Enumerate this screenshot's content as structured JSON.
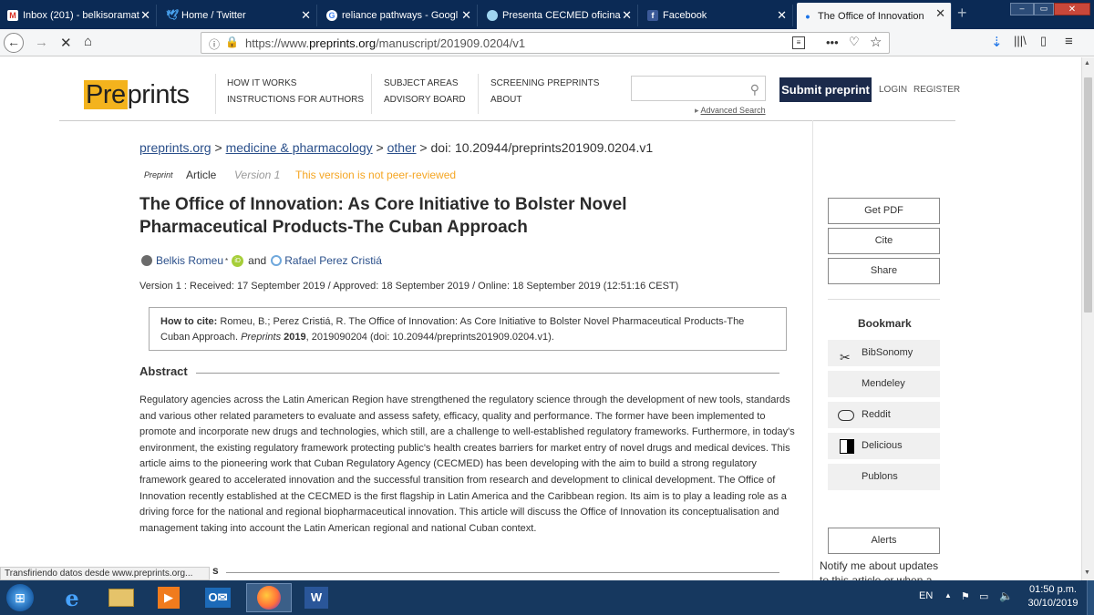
{
  "browser": {
    "tabs": [
      {
        "label": "Inbox (201) - belkisoramat",
        "icon": "gmail-icon"
      },
      {
        "label": "Home / Twitter",
        "icon": "twitter-icon"
      },
      {
        "label": "reliance pathways - Googl",
        "icon": "google-icon"
      },
      {
        "label": "Presenta CECMED oficina",
        "icon": "globe-icon"
      },
      {
        "label": "Facebook",
        "icon": "facebook-icon"
      },
      {
        "label": "The Office of Innovation",
        "icon": "preprints-icon"
      }
    ],
    "url_prefix": "https://www.",
    "url_domain": "preprints.org",
    "url_path": "/manuscript/201909.0204/v1",
    "status_text": "Transfiriendo datos desde www.preprints.org..."
  },
  "site": {
    "logo_highlight": "Pre",
    "logo_rest": "prints",
    "menu": {
      "how_it_works": "HOW IT WORKS",
      "instructions": "INSTRUCTIONS FOR AUTHORS",
      "subject_areas": "SUBJECT AREAS",
      "advisory_board": "ADVISORY BOARD",
      "screening": "SCREENING PREPRINTS",
      "about": "ABOUT"
    },
    "search_placeholder": "",
    "advanced_search": "Advanced Search",
    "submit": "Submit preprint",
    "login": "LOGIN",
    "register": "REGISTER"
  },
  "article": {
    "breadcrumb": {
      "home": "preprints.org",
      "sep1": " > ",
      "category": "medicine & pharmacology",
      "sep2": " > ",
      "subcategory": "other",
      "doi": " > doi: 10.20944/preprints201909.0204.v1"
    },
    "tag_preprint": "Preprint",
    "tag_article": "Article",
    "tag_version": "Version 1",
    "tag_review": "This version is not peer-reviewed",
    "title": "The Office of Innovation: As Core Initiative to Bolster Novel Pharmaceutical Products-The Cuban Approach",
    "author1": "Belkis Romeu",
    "author1_mark": "*",
    "and": "and",
    "author2": "Rafael Perez Cristiá",
    "dates": "Version 1 : Received: 17 September 2019 / Approved: 18 September 2019 / Online: 18 September 2019 (12:51:16 CEST)",
    "cite_label": "How to cite:",
    "cite_text1": " Romeu, B.; Perez Cristiá, R. The Office of Innovation: As Core Initiative to Bolster Novel Pharmaceutical Products-The Cuban Approach. ",
    "cite_journal": "Preprints",
    "cite_year": " 2019",
    "cite_text2": ", 2019090204 (doi: 10.20944/preprints201909.0204.v1).",
    "abstract_heading": "Abstract",
    "abstract": "Regulatory agencies across the Latin American Region have strengthened the regulatory science through the development of new tools, standards and various other related parameters to evaluate and assess safety, efficacy, quality and performance. The former have been implemented to promote and incorporate new drugs and technologies, which still, are a challenge to well-established regulatory frameworks. Furthermore, in today's environment, the existing regulatory framework protecting public's health creates barriers for market entry of novel drugs and medical devices. This article aims to the pioneering work that Cuban Regulatory Agency (CECMED) has been developing with the aim to build a strong regulatory framework geared to accelerated innovation and the successful transition from research and development to clinical development. The Office of Innovation recently established at the CECMED is the first flagship in Latin America and the Caribbean region. Its aim is to play a leading role as a driving force for the national and regional biopharmaceutical innovation. This article will discuss the Office of Innovation its conceptualisation and management taking into account the Latin American regional and national Cuban context.",
    "next_heading_fragment": "s"
  },
  "sidebar": {
    "get_pdf": "Get PDF",
    "cite": "Cite",
    "share": "Share",
    "bookmark_heading": "Bookmark",
    "bookmarks": [
      "BibSonomy",
      "Mendeley",
      "Reddit",
      "Delicious",
      "Publons"
    ],
    "alerts": "Alerts",
    "notify": "Notify me about updates to this article or when a"
  },
  "taskbar": {
    "lang": "EN",
    "time": "01:50 p.m.",
    "date": "30/10/2019"
  },
  "colors": {
    "logo_accent": "#f3b31d",
    "submit_bg": "#1b2a4b",
    "not_reviewed": "#f5a623",
    "link": "#2a4f8a"
  }
}
